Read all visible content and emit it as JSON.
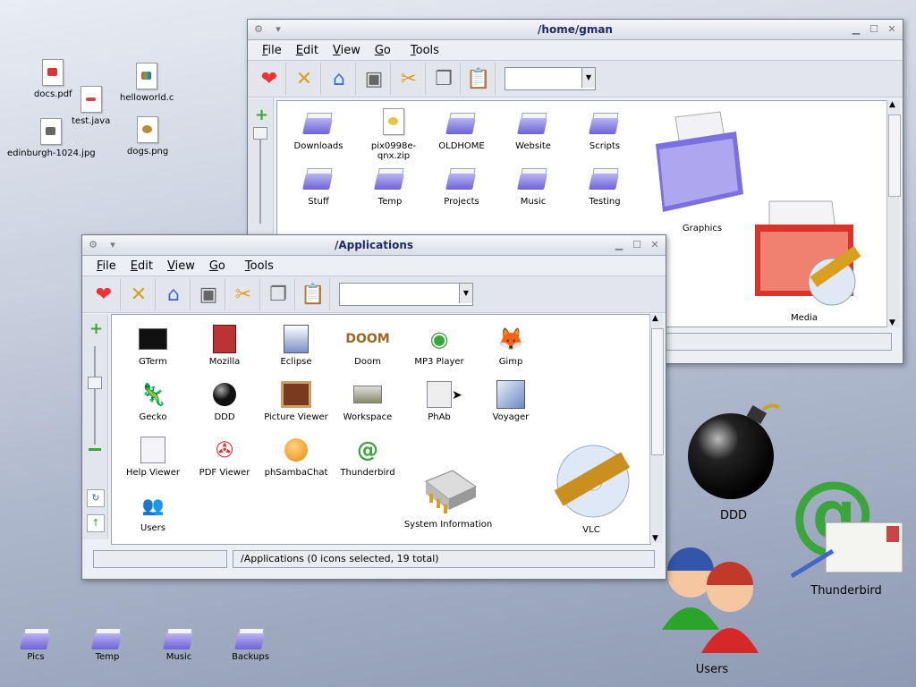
{
  "desktop": {
    "top_icons": [
      {
        "label": "docs.pdf",
        "icon": "pdf-file-icon"
      },
      {
        "label": "helloworld.c",
        "icon": "c-file-icon"
      },
      {
        "label": "test.java",
        "icon": "java-file-icon"
      },
      {
        "label": "edinburgh-1024.jpg",
        "icon": "image-file-icon"
      },
      {
        "label": "dogs.png",
        "icon": "image-file-icon"
      }
    ],
    "bottom_icons": [
      {
        "label": "Pics"
      },
      {
        "label": "Temp"
      },
      {
        "label": "Music"
      },
      {
        "label": "Backups"
      }
    ],
    "big_icons": [
      {
        "label": "DDD",
        "icon": "bomb-icon"
      },
      {
        "label": "Thunderbird",
        "icon": "email-icon"
      },
      {
        "label": "Users",
        "icon": "users-icon"
      }
    ]
  },
  "home_window": {
    "title": "/home/gman",
    "menu": [
      "File",
      "Edit",
      "View",
      "Go",
      "Tools"
    ],
    "items": [
      {
        "label": "Downloads"
      },
      {
        "label": "pix0998e-qnx.zip"
      },
      {
        "label": "OLDHOME"
      },
      {
        "label": "Website"
      },
      {
        "label": "Scripts"
      },
      {
        "label": "Stuff"
      },
      {
        "label": "Temp"
      },
      {
        "label": "Projects"
      },
      {
        "label": "Music"
      },
      {
        "label": "Testing"
      }
    ],
    "big_items": [
      {
        "label": "Graphics"
      },
      {
        "label": "Media"
      }
    ]
  },
  "apps_window": {
    "title": "/Applications",
    "menu": [
      "File",
      "Edit",
      "View",
      "Go",
      "Tools"
    ],
    "items": [
      {
        "label": "GTerm"
      },
      {
        "label": "Mozilla"
      },
      {
        "label": "Eclipse"
      },
      {
        "label": "Doom"
      },
      {
        "label": "MP3 Player"
      },
      {
        "label": "Gimp"
      },
      {
        "label": "Gecko"
      },
      {
        "label": "DDD"
      },
      {
        "label": "Picture Viewer"
      },
      {
        "label": "Workspace"
      },
      {
        "label": "PhAb"
      },
      {
        "label": "Voyager"
      },
      {
        "label": "Help Viewer"
      },
      {
        "label": "PDF Viewer"
      },
      {
        "label": "phSambaChat"
      },
      {
        "label": "Thunderbird"
      },
      {
        "label": "Users"
      },
      {
        "label": "System Information"
      },
      {
        "label": "VLC"
      }
    ],
    "status_text": "/Applications (0 icons selected, 19 total)"
  },
  "colors": {
    "title_text": "#1e2b6b",
    "folder": "#6e63d8",
    "accent_green": "#3aa53a"
  }
}
